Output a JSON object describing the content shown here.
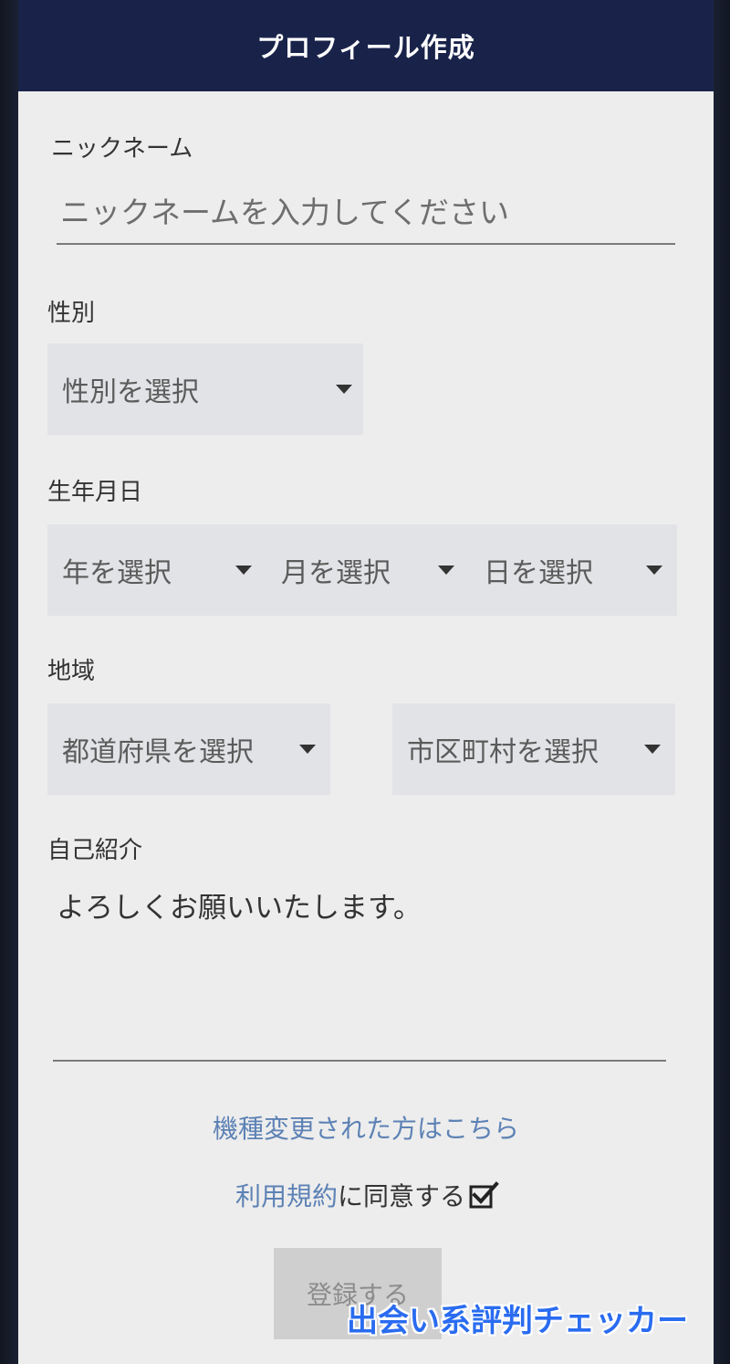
{
  "header": {
    "title": "プロフィール作成"
  },
  "nickname": {
    "label": "ニックネーム",
    "placeholder": "ニックネームを入力してください",
    "value": ""
  },
  "gender": {
    "label": "性別",
    "select_text": "性別を選択"
  },
  "birthdate": {
    "label": "生年月日",
    "year_text": "年を選択",
    "month_text": "月を選択",
    "day_text": "日を選択"
  },
  "region": {
    "label": "地域",
    "prefecture_text": "都道府県を選択",
    "city_text": "市区町村を選択"
  },
  "bio": {
    "label": "自己紹介",
    "value": "よろしくお願いいたします。"
  },
  "links": {
    "device_change": "機種変更された方はこちら",
    "terms_link": "利用規約",
    "terms_text": "に同意する",
    "terms_checked": true
  },
  "submit": {
    "label": "登録する"
  },
  "watermark": {
    "text": "出会い系評判チェッカー"
  },
  "colors": {
    "header_bg": "#19234a",
    "link": "#5d82b5",
    "select_bg": "#e2e3e6",
    "watermark": "#2a6cf0"
  }
}
